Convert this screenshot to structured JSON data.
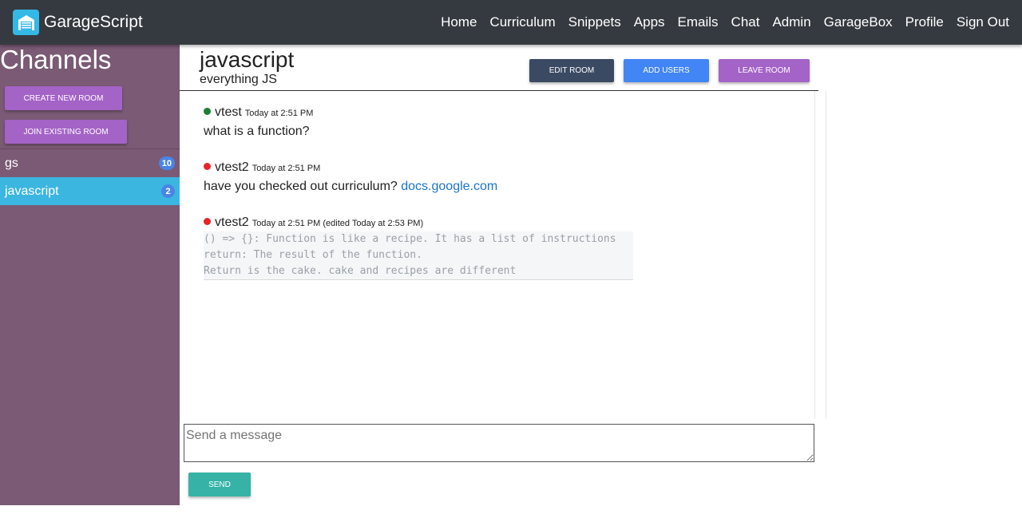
{
  "navbar": {
    "brand": "GarageScript",
    "links": [
      "Home",
      "Curriculum",
      "Snippets",
      "Apps",
      "Emails",
      "Chat",
      "Admin",
      "GarageBox",
      "Profile",
      "Sign Out"
    ]
  },
  "sidebar": {
    "title": "Channels",
    "create_room_label": "CREATE NEW ROOM",
    "join_room_label": "JOIN EXISTING ROOM",
    "rooms": [
      {
        "name": "gs",
        "count": "10",
        "active": false
      },
      {
        "name": "javascript",
        "count": "2",
        "active": true
      }
    ]
  },
  "room": {
    "title": "javascript",
    "description": "everything JS",
    "edit_label": "EDIT ROOM",
    "add_users_label": "ADD USERS",
    "leave_label": "LEAVE ROOM"
  },
  "messages": [
    {
      "author": "vtest",
      "status": "online",
      "time": "Today at 2:51 PM",
      "text": "what is a function?"
    },
    {
      "author": "vtest2",
      "status": "offline",
      "time": "Today at 2:51 PM",
      "text": "have you checked out curriculum?",
      "link": "docs.google.com"
    },
    {
      "author": "vtest2",
      "status": "offline",
      "time": "Today at 2:51 PM (edited Today at 2:53 PM)",
      "code": [
        "() => {}: Function is like a recipe. It has a list of instructions",
        "return: The result of the function.",
        "Return is the cake. cake and recipes are different"
      ]
    }
  ],
  "composer": {
    "placeholder": "Send a message",
    "send_label": "SEND"
  },
  "colors": {
    "navbar": "#353a40",
    "sidebar": "#7a5a74",
    "active_room": "#3bb6e1",
    "online": "#1e7e34",
    "offline": "#e8232a",
    "accent_purple": "#a463c7",
    "accent_blue": "#4285f4",
    "accent_teal": "#36b3a6"
  }
}
